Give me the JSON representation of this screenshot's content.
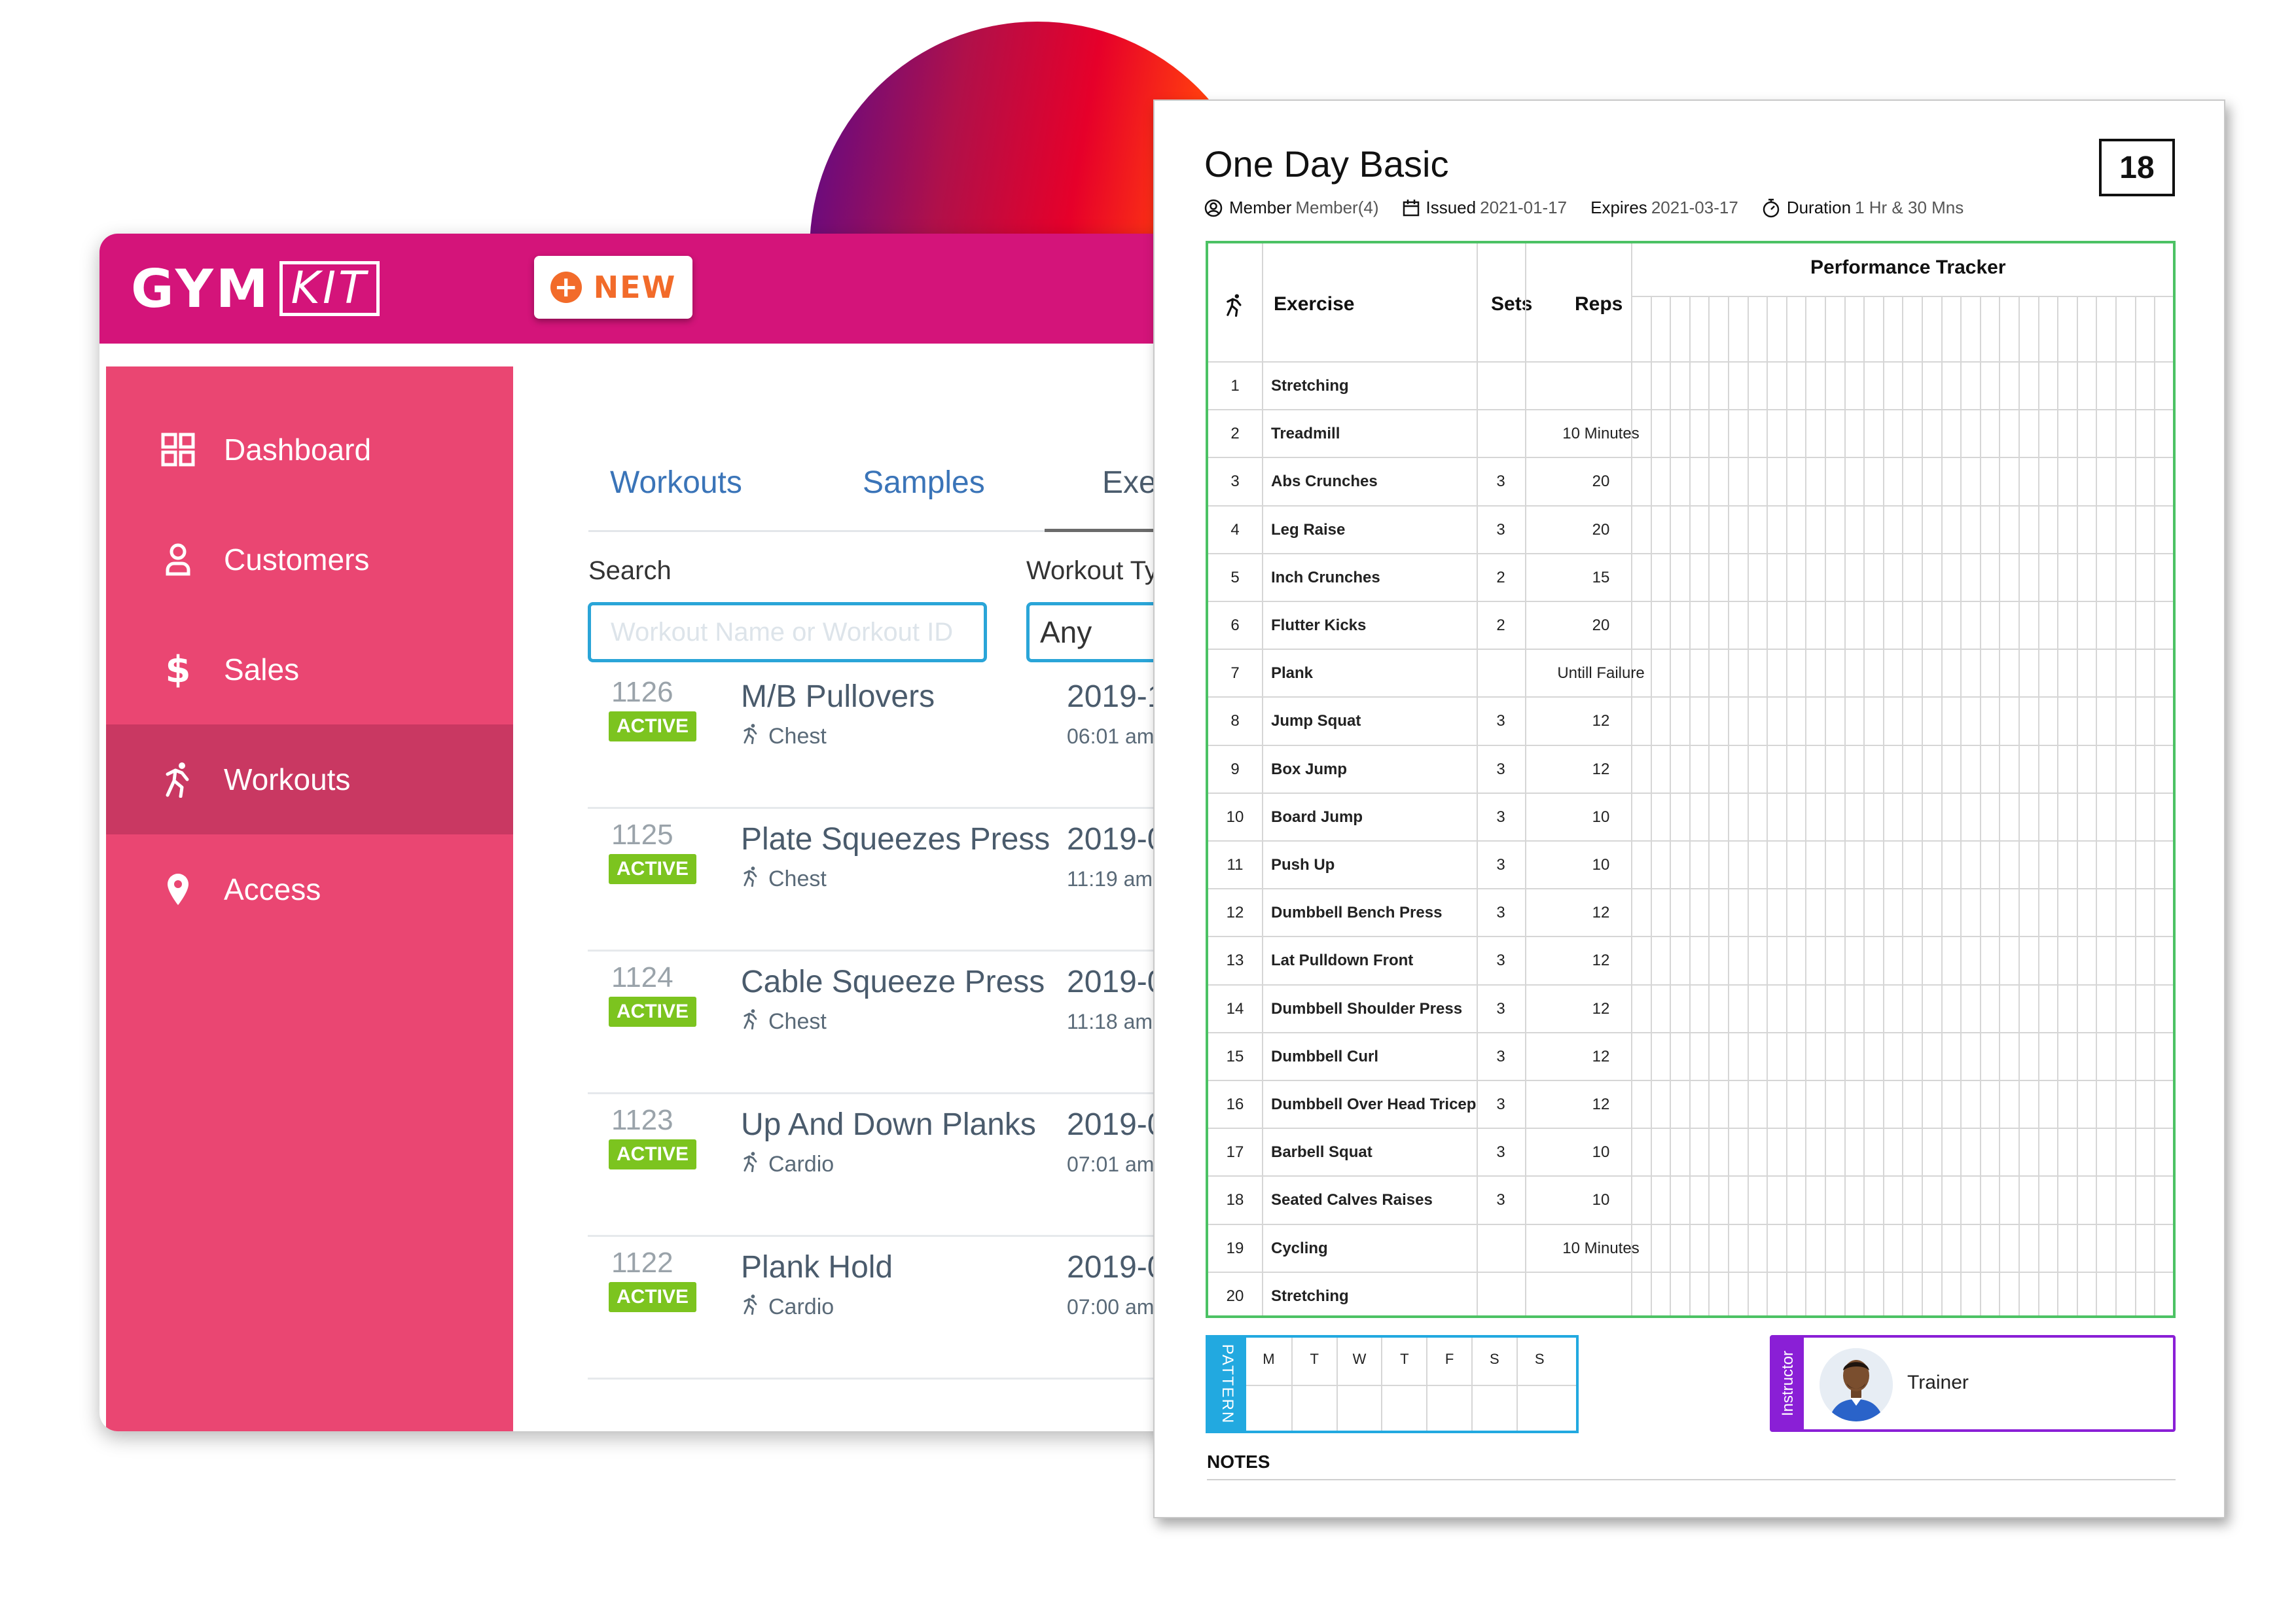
{
  "app": {
    "logo_main": "GYM",
    "logo_sub": "KIT",
    "new_button": "NEW",
    "sidebar": {
      "items": [
        {
          "label": "Dashboard",
          "icon": "dashboard-icon"
        },
        {
          "label": "Customers",
          "icon": "user-icon"
        },
        {
          "label": "Sales",
          "icon": "dollar-icon"
        },
        {
          "label": "Workouts",
          "icon": "runner-icon",
          "active": true
        },
        {
          "label": "Access",
          "icon": "location-pin-icon"
        }
      ]
    },
    "tabs": [
      "Workouts",
      "Samples",
      "Exer"
    ],
    "filters": {
      "search_label": "Search",
      "search_placeholder": "Workout Name or Workout ID",
      "type_label": "Workout Ty",
      "type_value": "Any"
    },
    "workouts": [
      {
        "id": "1126",
        "status": "ACTIVE",
        "name": "M/B Pullovers",
        "category": "Chest",
        "date": "2019-1",
        "time": "06:01 am"
      },
      {
        "id": "1125",
        "status": "ACTIVE",
        "name": "Plate Squeezes Press",
        "category": "Chest",
        "date": "2019-0",
        "time": "11:19 am"
      },
      {
        "id": "1124",
        "status": "ACTIVE",
        "name": "Cable Squeeze Press",
        "category": "Chest",
        "date": "2019-0",
        "time": "11:18 am"
      },
      {
        "id": "1123",
        "status": "ACTIVE",
        "name": "Up And Down Planks",
        "category": "Cardio",
        "date": "2019-0",
        "time": "07:01 am"
      },
      {
        "id": "1122",
        "status": "ACTIVE",
        "name": "Plank Hold",
        "category": "Cardio",
        "date": "2019-0",
        "time": "07:00 am"
      }
    ],
    "colors": {
      "brand": "#d4147a",
      "sidebar": "#ea4672",
      "active_badge": "#7cc41f",
      "accent": "#f26b2a"
    }
  },
  "sheet": {
    "title": "One Day Basic",
    "number": "18",
    "meta": {
      "member_key": "Member",
      "member_val": "Member(4)",
      "issued_key": "Issued",
      "issued_val": "2021-01-17",
      "expires_key": "Expires",
      "expires_val": "2021-03-17",
      "duration_key": "Duration",
      "duration_val": "1 Hr & 30 Mns"
    },
    "headers": {
      "exercise": "Exercise",
      "sets": "Sets",
      "reps": "Reps",
      "tracker": "Performance Tracker"
    },
    "rows": [
      {
        "n": "1",
        "exercise": "Stretching",
        "sets": "",
        "reps": ""
      },
      {
        "n": "2",
        "exercise": "Treadmill",
        "sets": "",
        "reps": "10 Minutes"
      },
      {
        "n": "3",
        "exercise": "Abs Crunches",
        "sets": "3",
        "reps": "20"
      },
      {
        "n": "4",
        "exercise": "Leg Raise",
        "sets": "3",
        "reps": "20"
      },
      {
        "n": "5",
        "exercise": "Inch Crunches",
        "sets": "2",
        "reps": "15"
      },
      {
        "n": "6",
        "exercise": "Flutter Kicks",
        "sets": "2",
        "reps": "20"
      },
      {
        "n": "7",
        "exercise": "Plank",
        "sets": "",
        "reps": "Untill Failure"
      },
      {
        "n": "8",
        "exercise": "Jump Squat",
        "sets": "3",
        "reps": "12"
      },
      {
        "n": "9",
        "exercise": "Box Jump",
        "sets": "3",
        "reps": "12"
      },
      {
        "n": "10",
        "exercise": "Board Jump",
        "sets": "3",
        "reps": "10"
      },
      {
        "n": "11",
        "exercise": "Push Up",
        "sets": "3",
        "reps": "10"
      },
      {
        "n": "12",
        "exercise": "Dumbbell Bench Press",
        "sets": "3",
        "reps": "12"
      },
      {
        "n": "13",
        "exercise": "Lat Pulldown Front",
        "sets": "3",
        "reps": "12"
      },
      {
        "n": "14",
        "exercise": "Dumbbell Shoulder Press",
        "sets": "3",
        "reps": "12"
      },
      {
        "n": "15",
        "exercise": "Dumbbell Curl",
        "sets": "3",
        "reps": "12"
      },
      {
        "n": "16",
        "exercise": "Dumbbell Over Head Tricep",
        "sets": "3",
        "reps": "12"
      },
      {
        "n": "17",
        "exercise": "Barbell Squat",
        "sets": "3",
        "reps": "10"
      },
      {
        "n": "18",
        "exercise": "Seated Calves Raises",
        "sets": "3",
        "reps": "10"
      },
      {
        "n": "19",
        "exercise": "Cycling",
        "sets": "",
        "reps": "10 Minutes"
      },
      {
        "n": "20",
        "exercise": "Stretching",
        "sets": "",
        "reps": ""
      }
    ],
    "pattern_label": "PATTERN",
    "days": [
      "M",
      "T",
      "W",
      "T",
      "F",
      "S",
      "S"
    ],
    "instructor_label": "Instructor",
    "trainer": "Trainer",
    "notes": "NOTES",
    "colors": {
      "table_border": "#4cc264",
      "pattern": "#22a9e0",
      "instructor": "#8a1fd6"
    }
  }
}
